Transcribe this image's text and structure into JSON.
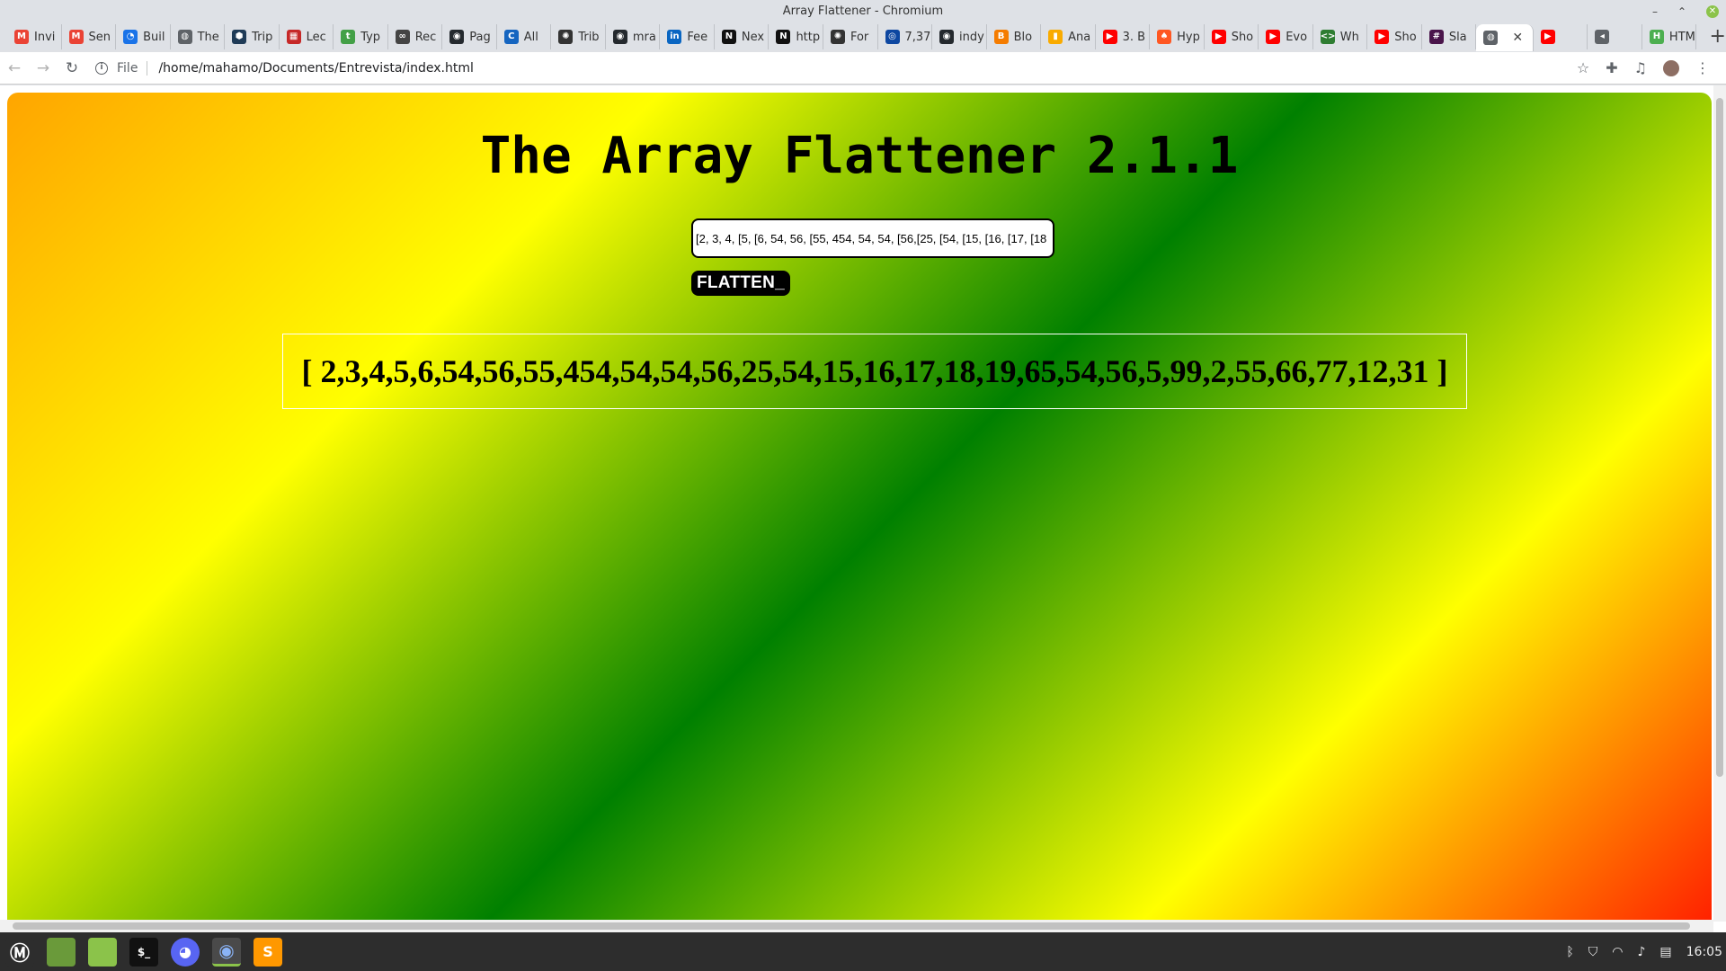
{
  "window": {
    "title": "Array Flattener - Chromium"
  },
  "tabs": [
    {
      "label": "Invi",
      "icon": "gmail-icon",
      "color": "#ea4335",
      "glyph": "M"
    },
    {
      "label": "Sen",
      "icon": "gmail-icon",
      "color": "#ea4335",
      "glyph": "M"
    },
    {
      "label": "Buil",
      "icon": "build-icon",
      "color": "#1a73e8",
      "glyph": "◔"
    },
    {
      "label": "The",
      "icon": "globe-icon",
      "color": "#5f6368",
      "glyph": "◍"
    },
    {
      "label": "Trip",
      "icon": "hexagon-icon",
      "color": "#1f3b57",
      "glyph": "⬢"
    },
    {
      "label": "Lec",
      "icon": "calendar-icon",
      "color": "#c62828",
      "glyph": "▦"
    },
    {
      "label": "Typ",
      "icon": "typo-icon",
      "color": "#43a047",
      "glyph": "t"
    },
    {
      "label": "Rec",
      "icon": "glasses-icon",
      "color": "#444444",
      "glyph": "∞"
    },
    {
      "label": "Pag",
      "icon": "github-icon",
      "color": "#24292e",
      "glyph": "◉"
    },
    {
      "label": "All",
      "icon": "c-icon",
      "color": "#1565c0",
      "glyph": "C"
    },
    {
      "label": "Trib",
      "icon": "openai-icon",
      "color": "#333333",
      "glyph": "✺"
    },
    {
      "label": "mra",
      "icon": "github-icon",
      "color": "#24292e",
      "glyph": "◉"
    },
    {
      "label": "Fee",
      "icon": "linkedin-icon",
      "color": "#0a66c2",
      "glyph": "in"
    },
    {
      "label": "Nex",
      "icon": "nexus-icon",
      "color": "#111111",
      "glyph": "N"
    },
    {
      "label": "http",
      "icon": "nexus-icon",
      "color": "#111111",
      "glyph": "N"
    },
    {
      "label": "For",
      "icon": "openai-icon",
      "color": "#333333",
      "glyph": "✺"
    },
    {
      "label": "7,37",
      "icon": "circle-icon",
      "color": "#0d47a1",
      "glyph": "◎"
    },
    {
      "label": "indy",
      "icon": "github-icon",
      "color": "#24292e",
      "glyph": "◉"
    },
    {
      "label": "Blo",
      "icon": "blogger-icon",
      "color": "#f57c00",
      "glyph": "B"
    },
    {
      "label": "Ana",
      "icon": "analytics-icon",
      "color": "#f9ab00",
      "glyph": "▮"
    },
    {
      "label": "3. B",
      "icon": "youtube-icon",
      "color": "#ff0000",
      "glyph": "▶"
    },
    {
      "label": "Hyp",
      "icon": "hype-icon",
      "color": "#ff5722",
      "glyph": "♠"
    },
    {
      "label": "Sho",
      "icon": "youtube-icon",
      "color": "#ff0000",
      "glyph": "▶"
    },
    {
      "label": "Evo",
      "icon": "youtube-icon",
      "color": "#ff0000",
      "glyph": "▶"
    },
    {
      "label": "Wh",
      "icon": "code-icon",
      "color": "#2e7d32",
      "glyph": "<>"
    },
    {
      "label": "Sho",
      "icon": "youtube-icon",
      "color": "#ff0000",
      "glyph": "▶"
    },
    {
      "label": "Sla",
      "icon": "slack-icon",
      "color": "#4a154b",
      "glyph": "#"
    },
    {
      "label": "",
      "icon": "globe-icon",
      "color": "#5f6368",
      "glyph": "◍",
      "active": true
    },
    {
      "label": "",
      "icon": "youtube-icon",
      "color": "#ff0000",
      "glyph": "▶"
    },
    {
      "label": "",
      "icon": "speaker-icon",
      "color": "#5f6368",
      "glyph": "◂"
    },
    {
      "label": "HTM",
      "icon": "html-icon",
      "color": "#4caf50",
      "glyph": "H"
    }
  ],
  "toolbar": {
    "scheme": "File",
    "url": "/home/mahamo/Documents/Entrevista/index.html"
  },
  "app": {
    "title": "The Array Flattener 2.1.1",
    "input_value": "[2, 3, 4, [5, [6, 54, 56, [55, 454, 54, 54, [56,[25, [54, [15, [16, [17, [18",
    "button_label": "FLATTEN_",
    "result": "[ 2,3,4,5,6,54,56,55,454,54,54,56,25,54,15,16,17,18,19,65,54,56,5,99,2,55,66,77,12,31 ]"
  },
  "taskbar": {
    "clock": "16:05"
  }
}
